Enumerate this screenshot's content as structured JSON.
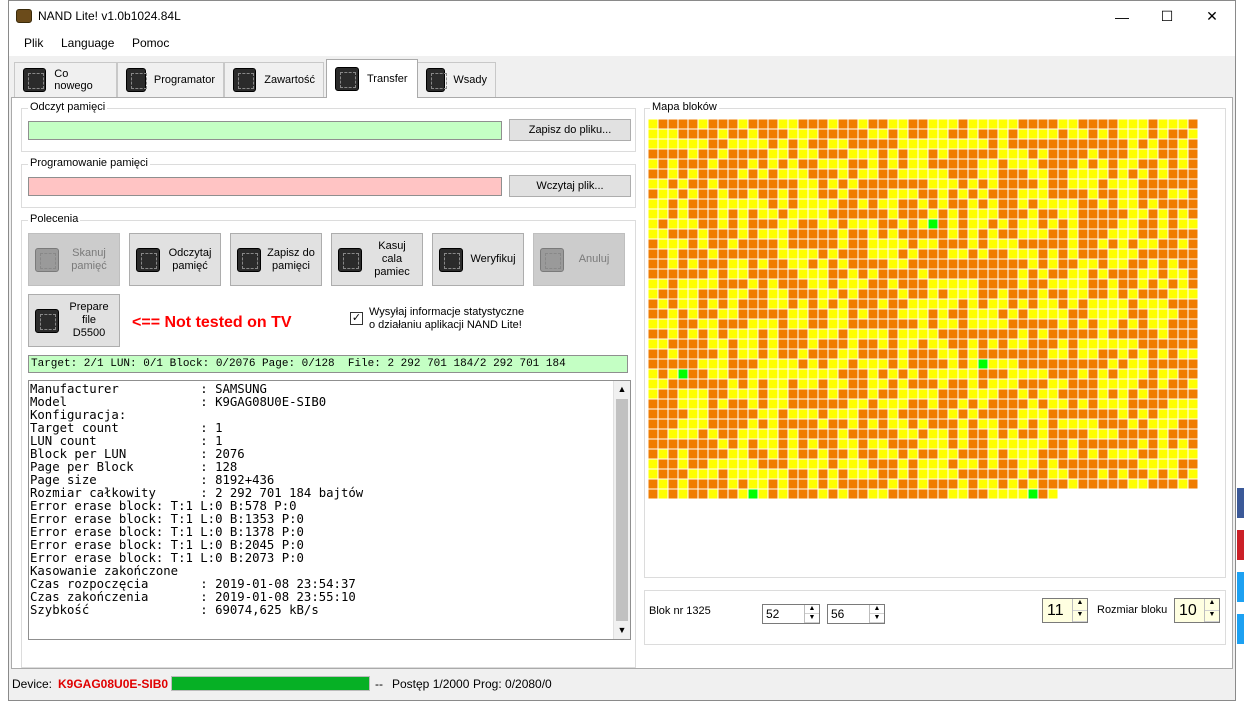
{
  "window": {
    "title": "NAND Lite! v1.0b1024.84L",
    "minimize_glyph": "—",
    "maximize_glyph": "☐",
    "close_glyph": "✕"
  },
  "menu": [
    "Plik",
    "Language",
    "Pomoc"
  ],
  "tabs": [
    {
      "label": "Co nowego",
      "icon": "chip-icon"
    },
    {
      "label": "Programator",
      "icon": "chip-icon"
    },
    {
      "label": "Zawartość",
      "icon": "chip-icon"
    },
    {
      "label": "Transfer",
      "icon": "chip-icon",
      "active": true
    },
    {
      "label": "Wsady",
      "icon": "chip-icon"
    }
  ],
  "read_group": {
    "title": "Odczyt pamięci",
    "button": "Zapisz do pliku...",
    "bar_color": "#c4ffc4"
  },
  "program_group": {
    "title": "Programowanie pamięci",
    "button": "Wczytaj plik...",
    "bar_color": "#ffc4c4"
  },
  "commands": {
    "title": "Polecenia",
    "buttons": [
      {
        "label": "Skanuj\npamięć",
        "enabled": false
      },
      {
        "label": "Odczytaj\npamięć",
        "enabled": true
      },
      {
        "label": "Zapisz do\npamięci",
        "enabled": true
      },
      {
        "label": "Kasuj cala\npamiec",
        "enabled": true
      },
      {
        "label": "Weryfikuj",
        "enabled": true
      },
      {
        "label": "Anuluj",
        "enabled": false
      }
    ],
    "prepare_button": "Prepare\nfile\nD5500",
    "warning": "<== Not tested on TV",
    "warning_color": "#ff0000",
    "stats_checkbox_checked": true,
    "stats_label_1": "Wysyłaj informacje statystyczne",
    "stats_label_2": "o działaniu aplikacji NAND Lite!"
  },
  "progress_text": "Target: 2/1 LUN: 0/1 Block: 0/2076 Page: 0/128  File: 2 292 701 184/2 292 701 184",
  "log": [
    "Manufacturer           : SAMSUNG",
    "Model                  : K9GAG08U0E-SIB0",
    "Konfiguracja:",
    "Target count           : 1",
    "LUN count              : 1",
    "Block per LUN          : 2076",
    "Page per Block         : 128",
    "Page size              : 8192+436",
    "Rozmiar całkowity      : 2 292 701 184 bajtów",
    "Error erase block: T:1 L:0 B:578 P:0",
    "Error erase block: T:1 L:0 B:1353 P:0",
    "Error erase block: T:1 L:0 B:1378 P:0",
    "Error erase block: T:1 L:0 B:2045 P:0",
    "Error erase block: T:1 L:0 B:2073 P:0",
    "Kasowanie zakończone",
    "Czas rozpoczęcia       : 2019-01-08 23:54:37",
    "Czas zakończenia       : 2019-01-08 23:55:10",
    "Szybkość               : 69074,625 kB/s"
  ],
  "block_map": {
    "title": "Mapa bloków",
    "columns": 55,
    "total_blocks": 2076,
    "colors": {
      "orange": "#f07c00",
      "yellow": "#ffff00",
      "green": "#00ff00"
    },
    "green_blocks": [
      578,
      1353,
      1378,
      2045,
      2073
    ]
  },
  "block_info": {
    "label": "Blok nr 1325",
    "spin1": "52",
    "spin2": "56",
    "spin3": "11",
    "size_label": "Rozmiar bloku",
    "size_value": "10"
  },
  "status": {
    "device_label": "Device:",
    "device_value": "K9GAG08U0E-SIB0",
    "progress": 1.0,
    "progress_color": "#06b025",
    "dashes": "--",
    "postep": "Postęp 1/2000",
    "prog": "Prog: 0/2080/0"
  }
}
